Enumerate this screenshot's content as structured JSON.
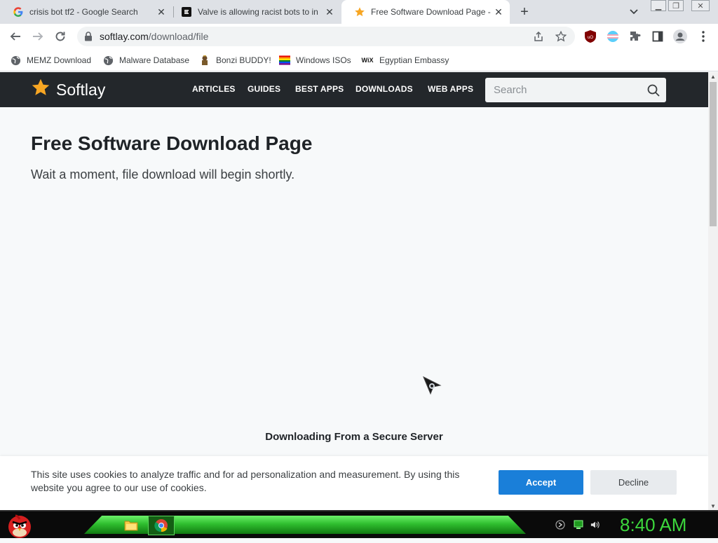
{
  "browser": {
    "tabs": [
      {
        "title": "crisis bot tf2 - Google Search",
        "icon": "google-icon"
      },
      {
        "title": "Valve is allowing racist bots to in",
        "icon": "engadget-icon"
      },
      {
        "title": "Free Software Download Page - S",
        "icon": "star-icon",
        "active": true
      }
    ],
    "url_host": "softlay.com",
    "url_path": "/download/file",
    "bookmarks": [
      {
        "label": "MEMZ Download",
        "icon": "globe-icon"
      },
      {
        "label": "Malware Database",
        "icon": "globe-icon"
      },
      {
        "label": "Bonzi BUDDY!",
        "icon": "bonzi-icon"
      },
      {
        "label": "Windows ISOs",
        "icon": "rainbow-flag-icon"
      },
      {
        "label": "Egyptian Embassy",
        "icon": "wix-icon"
      }
    ],
    "wix_text": "WiX"
  },
  "site": {
    "logo": "Softlay",
    "nav": [
      "ARTICLES",
      "GUIDES",
      "BEST APPS",
      "DOWNLOADS",
      "WEB APPS"
    ],
    "search_placeholder": "Search",
    "title": "Free Software Download Page",
    "subtitle": "Wait a moment, file download will begin shortly.",
    "server_line": "Downloading From a Secure Server",
    "cookie_text": "This site uses cookies to analyze traffic and for ad personalization and measurement. By using this website you agree to our use of cookies.",
    "accept": "Accept",
    "decline": "Decline",
    "accent": "#1a7fd9",
    "header_bg": "#23272b",
    "logo_star_color": "#f7a623"
  },
  "taskbar": {
    "clock": "8:40 AM",
    "clock_color": "#3cd63c",
    "apps": [
      "folder-icon",
      "chrome-icon"
    ]
  }
}
